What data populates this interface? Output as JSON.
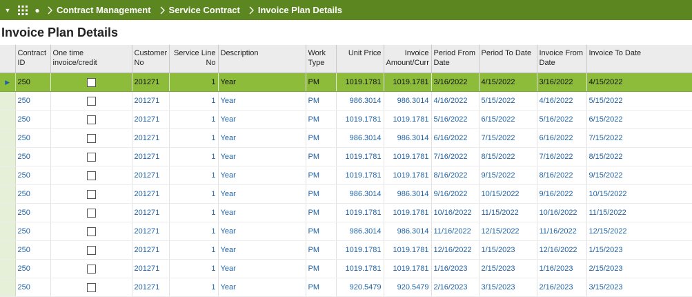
{
  "breadcrumbs": [
    "Contract Management",
    "Service Contract",
    "Invoice Plan Details"
  ],
  "page_title": "Invoice Plan Details",
  "columns": {
    "contract_id": "Contract ID",
    "one_time": "One time invoice/credit",
    "customer_no": "Customer No",
    "service_line": "Service Line No",
    "description": "Description",
    "work_type": "Work Type",
    "unit_price": "Unit Price",
    "invoice_amount": "Invoice Amount/Curr",
    "period_from": "Period From Date",
    "period_to": "Period To Date",
    "invoice_from": "Invoice From Date",
    "invoice_to": "Invoice To Date"
  },
  "rows": [
    {
      "contract_id": "250",
      "one_time": false,
      "customer_no": "201271",
      "service_line": "1",
      "description": "Year",
      "work_type": "PM",
      "unit_price": "1019.1781",
      "invoice_amount": "1019.1781",
      "period_from": "3/16/2022",
      "period_to": "4/15/2022",
      "invoice_from": "3/16/2022",
      "invoice_to": "4/15/2022"
    },
    {
      "contract_id": "250",
      "one_time": false,
      "customer_no": "201271",
      "service_line": "1",
      "description": "Year",
      "work_type": "PM",
      "unit_price": "986.3014",
      "invoice_amount": "986.3014",
      "period_from": "4/16/2022",
      "period_to": "5/15/2022",
      "invoice_from": "4/16/2022",
      "invoice_to": "5/15/2022"
    },
    {
      "contract_id": "250",
      "one_time": false,
      "customer_no": "201271",
      "service_line": "1",
      "description": "Year",
      "work_type": "PM",
      "unit_price": "1019.1781",
      "invoice_amount": "1019.1781",
      "period_from": "5/16/2022",
      "period_to": "6/15/2022",
      "invoice_from": "5/16/2022",
      "invoice_to": "6/15/2022"
    },
    {
      "contract_id": "250",
      "one_time": false,
      "customer_no": "201271",
      "service_line": "1",
      "description": "Year",
      "work_type": "PM",
      "unit_price": "986.3014",
      "invoice_amount": "986.3014",
      "period_from": "6/16/2022",
      "period_to": "7/15/2022",
      "invoice_from": "6/16/2022",
      "invoice_to": "7/15/2022"
    },
    {
      "contract_id": "250",
      "one_time": false,
      "customer_no": "201271",
      "service_line": "1",
      "description": "Year",
      "work_type": "PM",
      "unit_price": "1019.1781",
      "invoice_amount": "1019.1781",
      "period_from": "7/16/2022",
      "period_to": "8/15/2022",
      "invoice_from": "7/16/2022",
      "invoice_to": "8/15/2022"
    },
    {
      "contract_id": "250",
      "one_time": false,
      "customer_no": "201271",
      "service_line": "1",
      "description": "Year",
      "work_type": "PM",
      "unit_price": "1019.1781",
      "invoice_amount": "1019.1781",
      "period_from": "8/16/2022",
      "period_to": "9/15/2022",
      "invoice_from": "8/16/2022",
      "invoice_to": "9/15/2022"
    },
    {
      "contract_id": "250",
      "one_time": false,
      "customer_no": "201271",
      "service_line": "1",
      "description": "Year",
      "work_type": "PM",
      "unit_price": "986.3014",
      "invoice_amount": "986.3014",
      "period_from": "9/16/2022",
      "period_to": "10/15/2022",
      "invoice_from": "9/16/2022",
      "invoice_to": "10/15/2022"
    },
    {
      "contract_id": "250",
      "one_time": false,
      "customer_no": "201271",
      "service_line": "1",
      "description": "Year",
      "work_type": "PM",
      "unit_price": "1019.1781",
      "invoice_amount": "1019.1781",
      "period_from": "10/16/2022",
      "period_to": "11/15/2022",
      "invoice_from": "10/16/2022",
      "invoice_to": "11/15/2022"
    },
    {
      "contract_id": "250",
      "one_time": false,
      "customer_no": "201271",
      "service_line": "1",
      "description": "Year",
      "work_type": "PM",
      "unit_price": "986.3014",
      "invoice_amount": "986.3014",
      "period_from": "11/16/2022",
      "period_to": "12/15/2022",
      "invoice_from": "11/16/2022",
      "invoice_to": "12/15/2022"
    },
    {
      "contract_id": "250",
      "one_time": false,
      "customer_no": "201271",
      "service_line": "1",
      "description": "Year",
      "work_type": "PM",
      "unit_price": "1019.1781",
      "invoice_amount": "1019.1781",
      "period_from": "12/16/2022",
      "period_to": "1/15/2023",
      "invoice_from": "12/16/2022",
      "invoice_to": "1/15/2023"
    },
    {
      "contract_id": "250",
      "one_time": false,
      "customer_no": "201271",
      "service_line": "1",
      "description": "Year",
      "work_type": "PM",
      "unit_price": "1019.1781",
      "invoice_amount": "1019.1781",
      "period_from": "1/16/2023",
      "period_to": "2/15/2023",
      "invoice_from": "1/16/2023",
      "invoice_to": "2/15/2023"
    },
    {
      "contract_id": "250",
      "one_time": false,
      "customer_no": "201271",
      "service_line": "1",
      "description": "Year",
      "work_type": "PM",
      "unit_price": "920.5479",
      "invoice_amount": "920.5479",
      "period_from": "2/16/2023",
      "period_to": "3/15/2023",
      "invoice_from": "2/16/2023",
      "invoice_to": "3/15/2023"
    }
  ],
  "selected_row": 0,
  "colors": {
    "header_bar": "#5c861f",
    "selected_row": "#8cbc3a",
    "link_text": "#1f62a4"
  }
}
